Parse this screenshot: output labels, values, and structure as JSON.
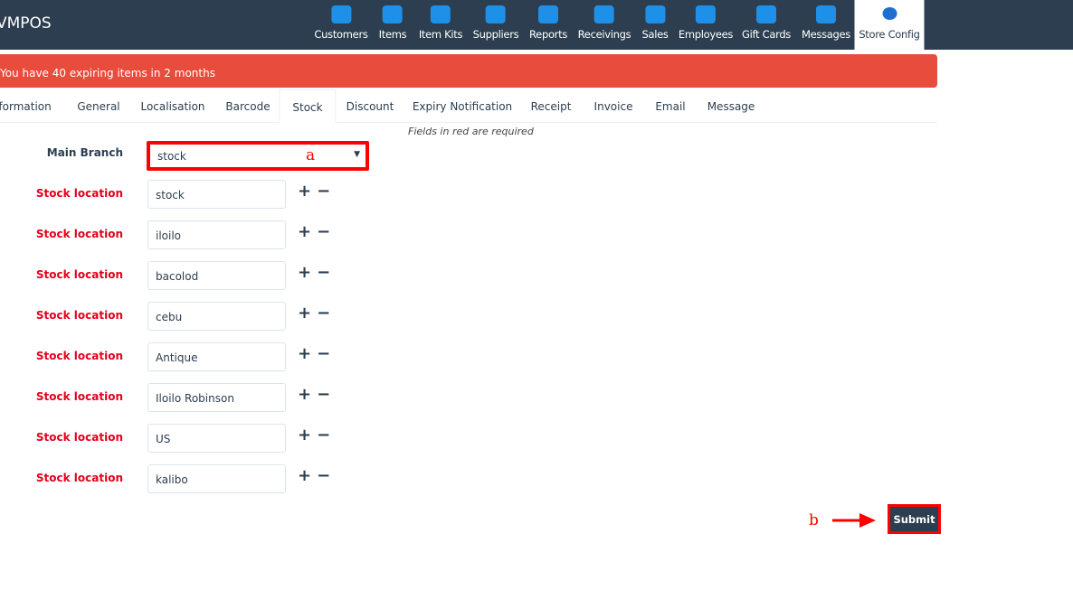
{
  "app": {
    "brand": "VMPOS"
  },
  "nav": [
    {
      "label": "Customers",
      "icon": "customers-icon"
    },
    {
      "label": "Items",
      "icon": "basket-icon"
    },
    {
      "label": "Item Kits",
      "icon": "bag-icon"
    },
    {
      "label": "Suppliers",
      "icon": "warehouse-icon"
    },
    {
      "label": "Reports",
      "icon": "report-icon"
    },
    {
      "label": "Receivings",
      "icon": "receiving-icon"
    },
    {
      "label": "Sales",
      "icon": "cart-icon"
    },
    {
      "label": "Employees",
      "icon": "employees-icon"
    },
    {
      "label": "Gift Cards",
      "icon": "gift-card-icon"
    },
    {
      "label": "Messages",
      "icon": "envelope-icon"
    },
    {
      "label": "Store Config",
      "icon": "gears-icon",
      "active": true
    }
  ],
  "alert": "You have 40 expiring items in 2 months",
  "tabs": [
    "Information",
    "General",
    "Localisation",
    "Barcode",
    "Stock",
    "Discount",
    "Expiry Notification",
    "Receipt",
    "Invoice",
    "Email",
    "Message"
  ],
  "active_tab": "Stock",
  "required_note": "Fields in red are required",
  "main_branch": {
    "label": "Main Branch",
    "value": "stock"
  },
  "stock_label": "Stock location",
  "locations": [
    "stock",
    "iloilo",
    "bacolod",
    "cebu",
    "Antique",
    "Iloilo Robinson",
    "US",
    "kalibo"
  ],
  "annotations": {
    "a": "a",
    "b": "b"
  },
  "submit_label": "Submit",
  "colors": {
    "navbar": "#2c3e50",
    "alert": "#e74c3c",
    "required": "#e3001b",
    "highlight": "#ff0000"
  }
}
